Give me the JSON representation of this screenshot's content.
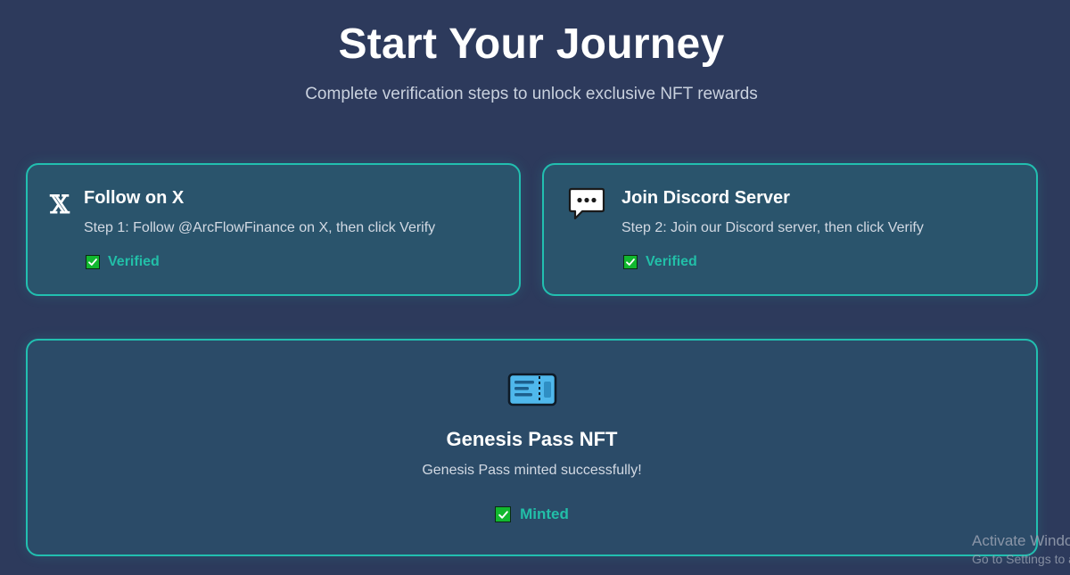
{
  "header": {
    "title": "Start Your Journey",
    "subtitle": "Complete verification steps to unlock exclusive NFT rewards"
  },
  "steps": [
    {
      "icon": "x-logo-icon",
      "icon_glyph": "𝕏",
      "title": "Follow on X",
      "description": "Step 1: Follow @ArcFlowFinance on X, then click Verify",
      "status": "Verified"
    },
    {
      "icon": "speech-bubble-icon",
      "title": "Join Discord Server",
      "description": "Step 2: Join our Discord server, then click Verify",
      "status": "Verified"
    }
  ],
  "reward": {
    "icon": "ticket-icon",
    "title": "Genesis Pass NFT",
    "description": "Genesis Pass minted successfully!",
    "status": "Minted"
  },
  "watermark": {
    "line1": "Activate Windows",
    "line2": "Go to Settings to activate Windows."
  },
  "colors": {
    "background": "#2d3a5c",
    "accent": "#22bfb0",
    "status_text": "#22bfa8",
    "check_green": "#12b82f"
  }
}
